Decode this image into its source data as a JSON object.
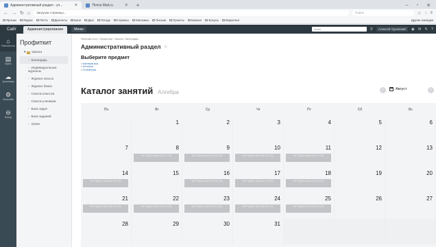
{
  "browser": {
    "tabs": [
      {
        "label": "Административный раздел - уч...",
        "active": true
      },
      {
        "label": "Почта Mail.ru",
        "active": false
      }
    ],
    "url": "Загрузка страницы...",
    "search_placeholder": "Поиск",
    "bookmarks": [
      "Ярлыки",
      "Яндекс",
      "Почта",
      "Диктанты",
      "Бали",
      "Диск",
      "Погода",
      "Сервисы",
      "Магазины",
      "Письма",
      "Проекты",
      "Банкинг",
      "Бонусы",
      "Маркетинг"
    ],
    "bookmarks_other": "Другие закладки"
  },
  "navbar": {
    "brand": "Сайт",
    "admin_tab": "Администрирование",
    "menu_label": "Меню",
    "search_placeholder": "поиск",
    "user": "Алексей Туровский"
  },
  "rail": [
    {
      "icon": "home-icon",
      "glyph": "⌂",
      "label": "Рабочий стол"
    },
    {
      "icon": "courses-icon",
      "glyph": "▤",
      "label": "Курсы"
    },
    {
      "icon": "cloud-icon",
      "glyph": "☁",
      "label": "Хранилище"
    },
    {
      "icon": "gear-icon",
      "glyph": "⚙",
      "label": "Настройки"
    },
    {
      "icon": "logout-icon",
      "glyph": "⊖",
      "label": "Выход"
    }
  ],
  "drawer": {
    "title": "Профиткит",
    "root": "Школа",
    "items": [
      {
        "label": "Календарь",
        "active": true
      },
      {
        "label": "Индивидуальные журналы",
        "active": false
      },
      {
        "label": "Журнал класса",
        "active": false
      },
      {
        "label": "Журнал банка",
        "active": false
      },
      {
        "label": "Список классов",
        "active": false
      },
      {
        "label": "Список учеников",
        "active": false
      },
      {
        "label": "База задач",
        "active": false
      },
      {
        "label": "База заданий",
        "active": false
      },
      {
        "label": "Уроки",
        "active": false
      }
    ]
  },
  "main": {
    "breadcrumb": "Рабочий стол › Профиткит › Школа › Календарь",
    "page_title": "Административный раздел",
    "subtitle": "Выберите предмет",
    "subjects": [
      "Математика",
      "Алгебра",
      "Геометрия"
    ],
    "catalog_title": "Каталог занятий",
    "catalog_subject": "Алгебра",
    "month_label": "Август"
  },
  "calendar": {
    "weekdays": [
      "Пн",
      "Вт",
      "Ср",
      "Чт",
      "Пт",
      "Сб",
      "Вс"
    ],
    "weeks": [
      [
        {
          "n": ""
        },
        {
          "n": "1"
        },
        {
          "n": "2"
        },
        {
          "n": "3"
        },
        {
          "n": "4"
        },
        {
          "n": "5"
        },
        {
          "n": "6"
        }
      ],
      [
        {
          "n": "7"
        },
        {
          "n": "8",
          "ev": "МЕТОДИКА ШКОЛЫ 21 (7/8)"
        },
        {
          "n": "9",
          "ev": "МЕТОДИКА ШКОЛЫ 22 (7/8)"
        },
        {
          "n": "10",
          "ev": "МЕТОДИКА ШКОЛЫ 23 (7/8)"
        },
        {
          "n": "11",
          "ev": "МЕТОДИКА ШКОЛЫ 24 (7/8)"
        },
        {
          "n": "12"
        },
        {
          "n": "13"
        }
      ],
      [
        {
          "n": "14",
          "ev": "МЕТОДИКА ШКОЛЫ 25 (7/8)"
        },
        {
          "n": "15"
        },
        {
          "n": "16",
          "ev": "МЕТОДИКА ШКОЛЫ 26 (7/8)"
        },
        {
          "n": "17",
          "ev": "МЕТОДИКА ШКОЛЫ 27 (7/8)"
        },
        {
          "n": "18",
          "ev": "МЕТОДИКА ШКОЛЫ 28 (7/8)"
        },
        {
          "n": "19"
        },
        {
          "n": "20"
        }
      ],
      [
        {
          "n": "21",
          "ev": "МЕТОДИКА ШКОЛЫ 30 (7/8)"
        },
        {
          "n": "22",
          "ev": "МЕТОДИКА ШКОЛЫ 31 (7/8)"
        },
        {
          "n": "23",
          "ev": "МЕТОДИКА ШКОЛЫ 32 (7/8)"
        },
        {
          "n": "24",
          "ev": "МЕТОДИКА ШКОЛЫ 33 (7/8)"
        },
        {
          "n": "25",
          "ev": "МЕТОДИКА ШКОЛЫ 34 (7/8)"
        },
        {
          "n": "26"
        },
        {
          "n": "27"
        }
      ],
      [
        {
          "n": "28"
        },
        {
          "n": "29"
        },
        {
          "n": "30"
        },
        {
          "n": "31"
        },
        {
          "n": "",
          "empty": true
        },
        {
          "n": "",
          "empty": true
        },
        {
          "n": "",
          "empty": true
        }
      ]
    ]
  },
  "colors": {
    "navbar": "#2d3941",
    "rail": "#3a4a54",
    "event": "#c2c4c7",
    "link": "#2a6fb5"
  }
}
